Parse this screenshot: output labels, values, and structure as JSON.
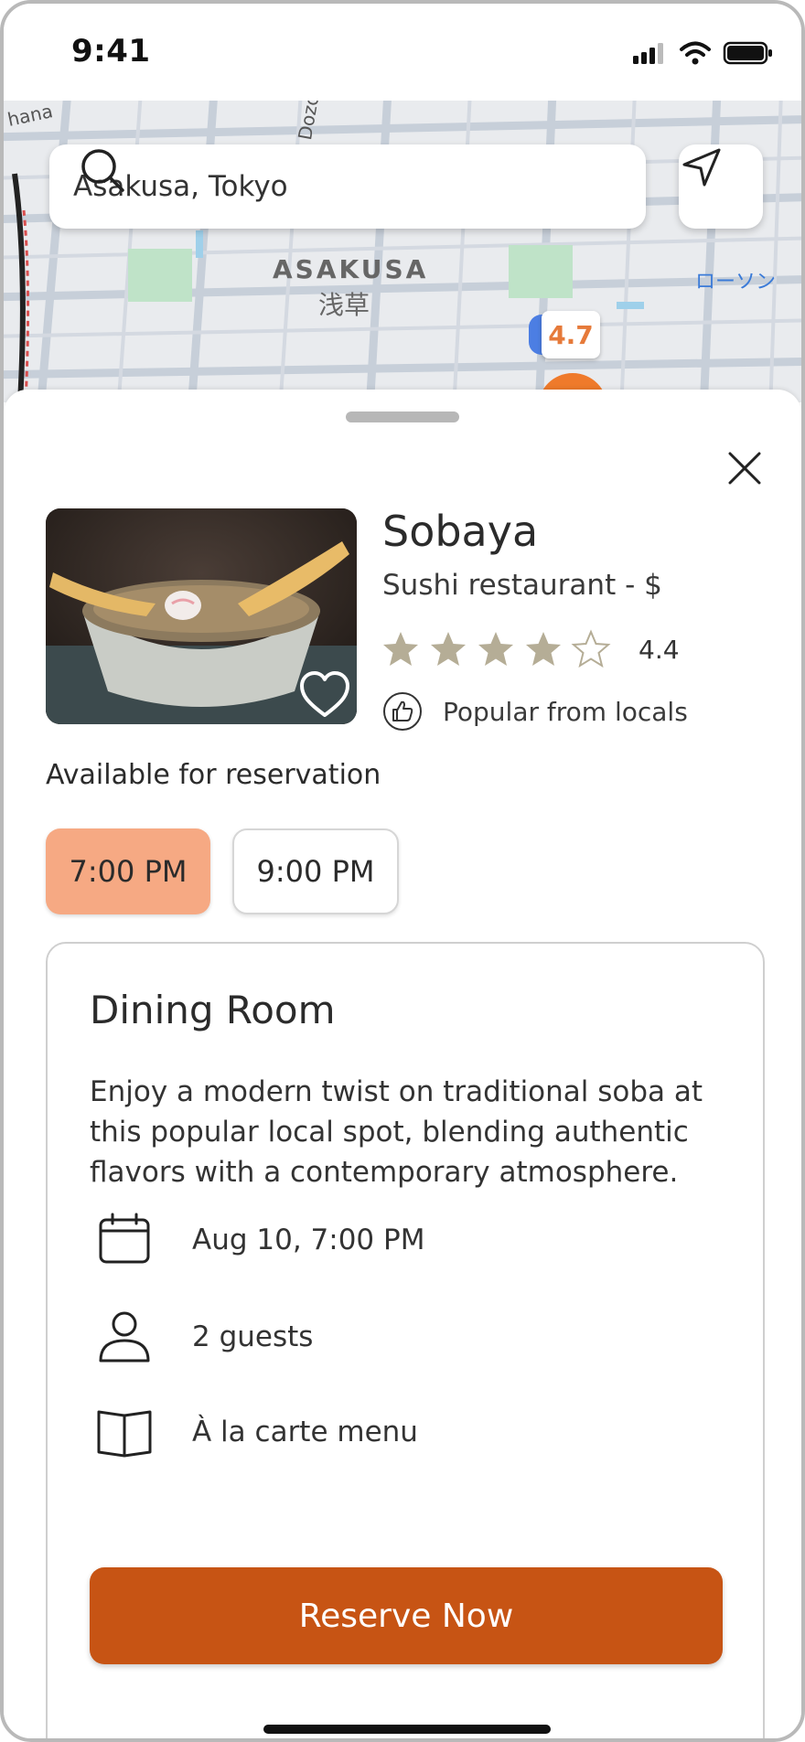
{
  "status": {
    "time": "9:41"
  },
  "map": {
    "area_label": "ASAKUSA",
    "area_label_jp": "浅草",
    "shop_label": "ローソン",
    "corner_label": "hana",
    "street_label": "Dozo",
    "pin_rating": "4.7"
  },
  "search": {
    "value": "Asakusa, Tokyo"
  },
  "restaurant": {
    "name": "Sobaya",
    "type": "Sushi restaurant - $",
    "rating": "4.4",
    "stars_filled": 4,
    "stars_total": 5,
    "popular": "Popular from locals"
  },
  "reservation": {
    "heading": "Available for reservation",
    "slots": [
      {
        "label": "7:00 PM",
        "selected": true
      },
      {
        "label": "9:00 PM",
        "selected": false
      }
    ]
  },
  "card": {
    "title": "Dining Room",
    "description": "Enjoy a modern twist on traditional soba at this popular local spot, blending authentic flavors with a contemporary atmosphere.",
    "details": [
      {
        "icon": "calendar-icon",
        "label": "Aug 10, 7:00 PM"
      },
      {
        "icon": "person-icon",
        "label": "2 guests"
      },
      {
        "icon": "menu-book-icon",
        "label": "À la carte menu"
      }
    ],
    "cta": "Reserve Now"
  },
  "colors": {
    "accent": "#c75414",
    "selected_slot": "#f6a983",
    "star": "#b5ad96",
    "pin": "#e67a3a"
  }
}
